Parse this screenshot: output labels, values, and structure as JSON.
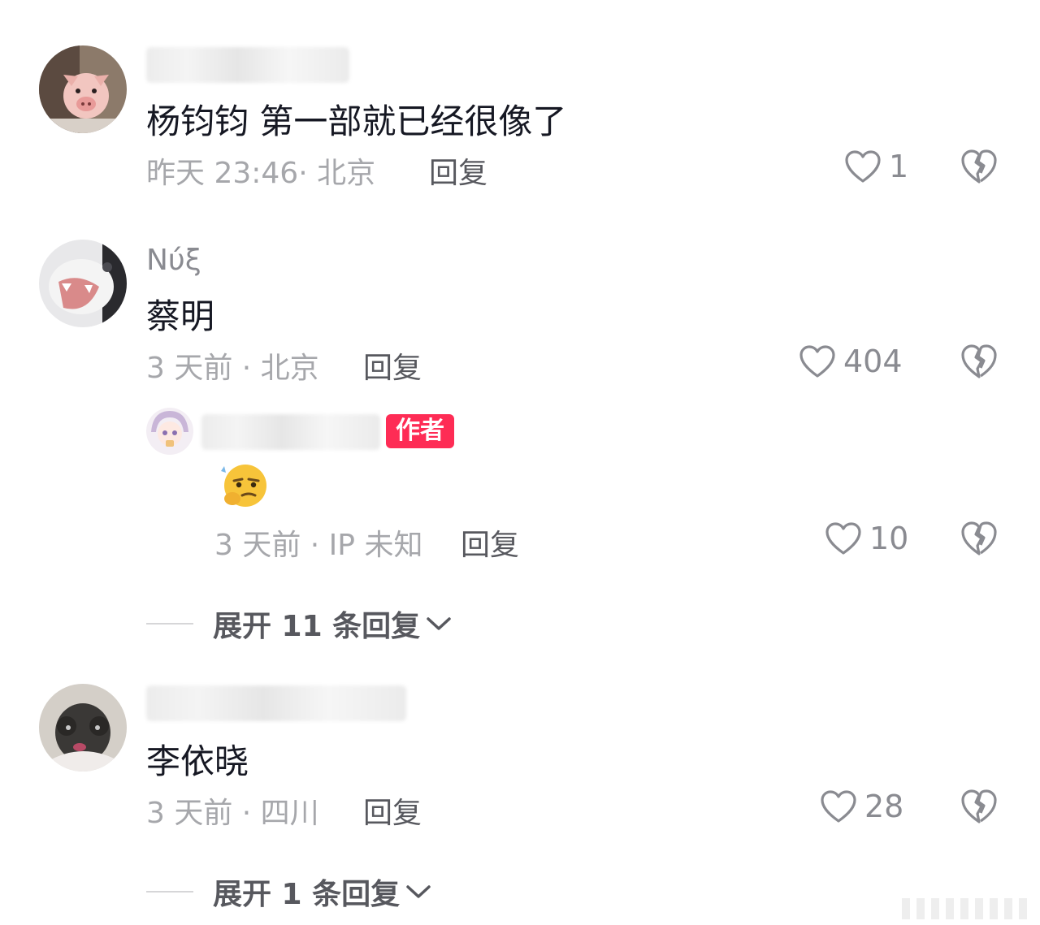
{
  "comments": [
    {
      "author": "",
      "text": "杨钧钧 第一部就已经很像了",
      "meta": "昨天 23:46· 北京",
      "reply_label": "回复",
      "likes": "1"
    },
    {
      "author": "Νύξ",
      "text": "蔡明",
      "meta": "3 天前 · 北京",
      "reply_label": "回复",
      "likes": "404",
      "sub_reply": {
        "badge": "作者",
        "emoji": "thinking-face-emoji",
        "meta": "3 天前 · IP 未知",
        "reply_label": "回复",
        "likes": "10"
      },
      "expand_label": "展开 11 条回复"
    },
    {
      "author": "",
      "text": "李依晓",
      "meta": "3 天前 · 四川",
      "reply_label": "回复",
      "likes": "28",
      "expand_label": "展开 1 条回复"
    }
  ],
  "icons": {
    "like": "heart-outline-icon",
    "dislike": "broken-heart-icon",
    "expand": "chevron-down-icon"
  },
  "colors": {
    "badge": "#fe2c55",
    "text": "#161823",
    "meta": "#a6a7ab"
  }
}
